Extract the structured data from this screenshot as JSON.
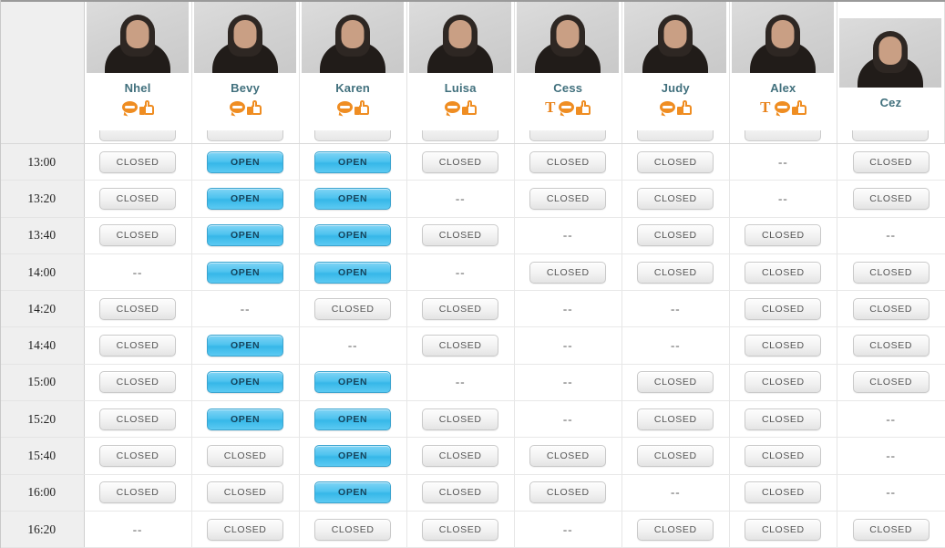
{
  "meta": {
    "time_column_header": "",
    "open_label": "OPEN",
    "closed_label": "CLOSED",
    "empty_label": "--",
    "accent_open": "#4fc3ef",
    "accent_closed": "#e4e4e4",
    "name_color": "#41707d",
    "icon_color": "#ef8d22",
    "time_column_bg": "#efefef"
  },
  "agents": [
    {
      "name": "Nhel",
      "icons": [
        "chat-bubble-icon",
        "thumbs-up-icon"
      ],
      "shifted": false
    },
    {
      "name": "Bevy",
      "icons": [
        "chat-bubble-icon",
        "thumbs-up-icon"
      ],
      "shifted": false
    },
    {
      "name": "Karen",
      "icons": [
        "chat-bubble-icon",
        "thumbs-up-icon"
      ],
      "shifted": false
    },
    {
      "name": "Luisa",
      "icons": [
        "chat-bubble-icon",
        "thumbs-up-icon"
      ],
      "shifted": false
    },
    {
      "name": "Cess",
      "icons": [
        "text-t-icon",
        "chat-bubble-icon",
        "thumbs-up-icon"
      ],
      "shifted": false
    },
    {
      "name": "Judy",
      "icons": [
        "chat-bubble-icon",
        "thumbs-up-icon"
      ],
      "shifted": false
    },
    {
      "name": "Alex",
      "icons": [
        "text-t-icon",
        "chat-bubble-icon",
        "thumbs-up-icon"
      ],
      "shifted": false
    },
    {
      "name": "Cez",
      "icons": [],
      "shifted": true
    }
  ],
  "times": [
    "13:00",
    "13:20",
    "13:40",
    "14:00",
    "14:20",
    "14:40",
    "15:00",
    "15:20",
    "15:40",
    "16:00",
    "16:20"
  ],
  "schedule": [
    [
      "CLOSED",
      "OPEN",
      "OPEN",
      "CLOSED",
      "CLOSED",
      "CLOSED",
      "--",
      "CLOSED"
    ],
    [
      "CLOSED",
      "OPEN",
      "OPEN",
      "--",
      "CLOSED",
      "CLOSED",
      "--",
      "CLOSED"
    ],
    [
      "CLOSED",
      "OPEN",
      "OPEN",
      "CLOSED",
      "--",
      "CLOSED",
      "CLOSED",
      "--"
    ],
    [
      "--",
      "OPEN",
      "OPEN",
      "--",
      "CLOSED",
      "CLOSED",
      "CLOSED",
      "CLOSED"
    ],
    [
      "CLOSED",
      "--",
      "CLOSED",
      "CLOSED",
      "--",
      "--",
      "CLOSED",
      "CLOSED"
    ],
    [
      "CLOSED",
      "OPEN",
      "--",
      "CLOSED",
      "--",
      "--",
      "CLOSED",
      "CLOSED"
    ],
    [
      "CLOSED",
      "OPEN",
      "OPEN",
      "--",
      "--",
      "CLOSED",
      "CLOSED",
      "CLOSED"
    ],
    [
      "CLOSED",
      "OPEN",
      "OPEN",
      "CLOSED",
      "--",
      "CLOSED",
      "CLOSED",
      "--"
    ],
    [
      "CLOSED",
      "CLOSED",
      "OPEN",
      "CLOSED",
      "CLOSED",
      "CLOSED",
      "CLOSED",
      "--"
    ],
    [
      "CLOSED",
      "CLOSED",
      "OPEN",
      "CLOSED",
      "CLOSED",
      "--",
      "CLOSED",
      "--"
    ],
    [
      "--",
      "CLOSED",
      "CLOSED",
      "CLOSED",
      "--",
      "CLOSED",
      "CLOSED",
      "CLOSED"
    ]
  ]
}
